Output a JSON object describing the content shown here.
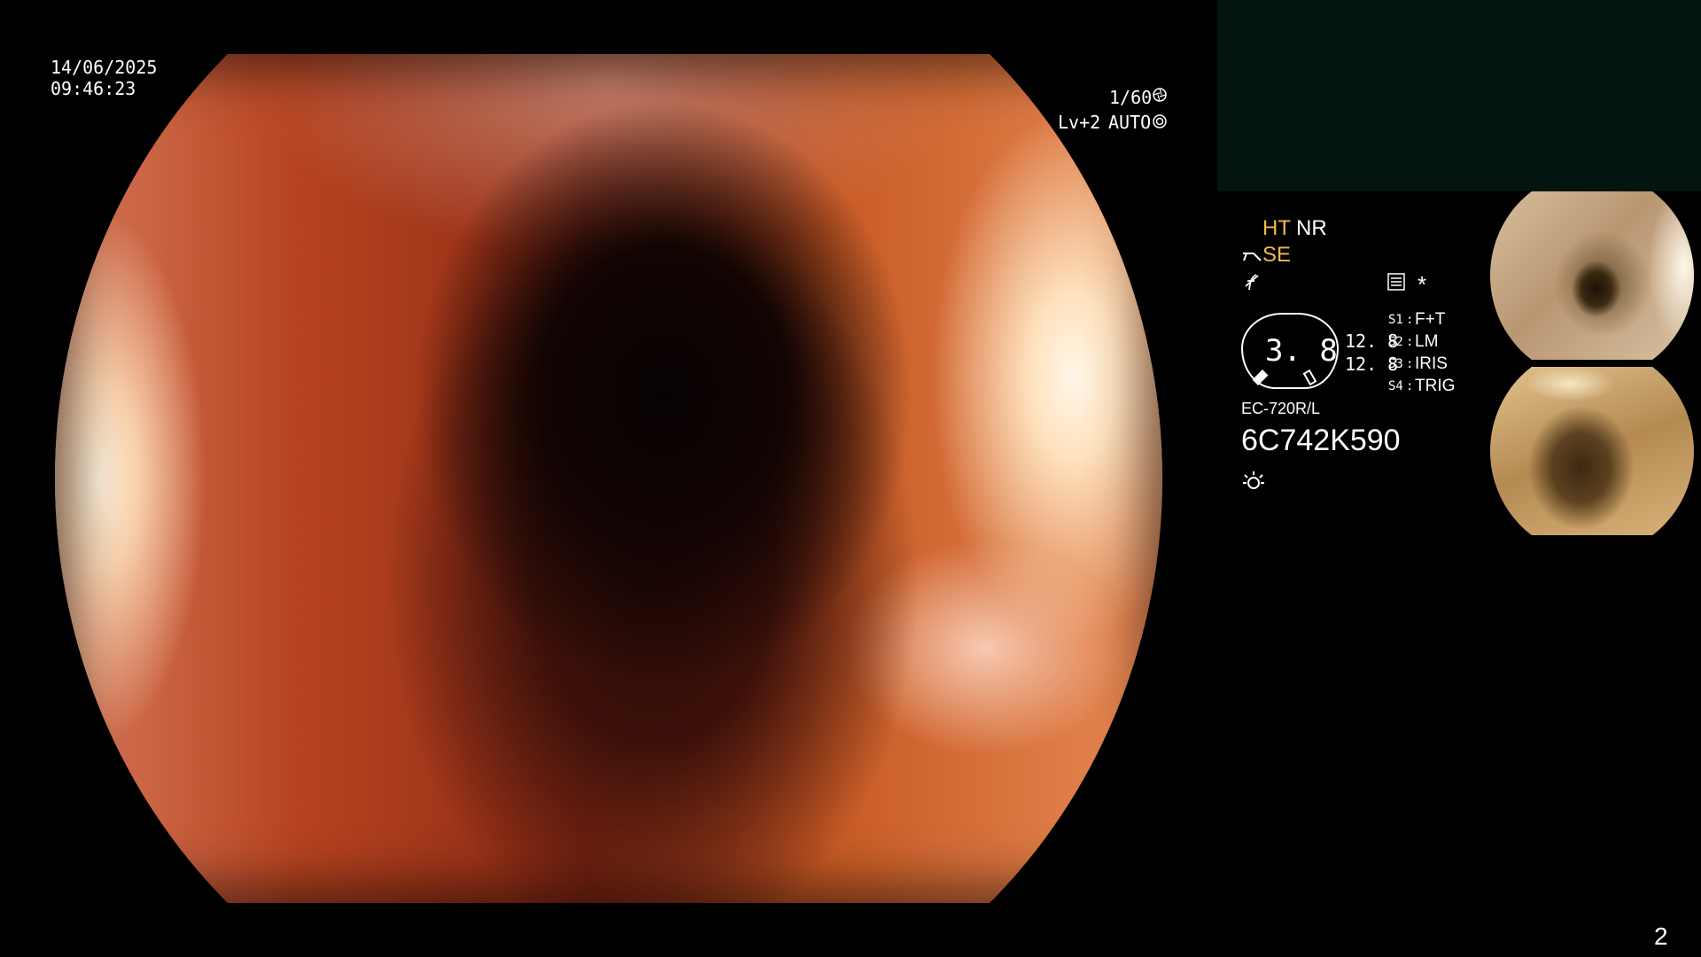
{
  "overlay": {
    "date": "14/06/2025",
    "time": "09:46:23",
    "shutter": "1/60",
    "shutter_icon": "aperture-icon",
    "level": "Lv+2",
    "mode": "AUTO",
    "mode_icon": "target-icon"
  },
  "settings": {
    "ht": "HT",
    "nr": "NR",
    "se": "SE",
    "se_icon": "scope-tip-icon",
    "f_icon": "f-slash-icon",
    "panel_icon": "settings-panel-icon",
    "asterisk": "*",
    "center_value": "3. 8",
    "left_value_top": "12. 8",
    "left_value_bottom": "12. 8",
    "switches": [
      {
        "key": "S1",
        "value": "F+T"
      },
      {
        "key": "S2",
        "value": "LM"
      },
      {
        "key": "S3",
        "value": "IRIS"
      },
      {
        "key": "S4",
        "value": "TRIG"
      }
    ],
    "model": "EC-720R/L",
    "serial": "6C742K590",
    "light_icon": "sun-icon"
  },
  "page_number": "2",
  "colors": {
    "accent_yellow": "#f0b94a",
    "panel_dark": "#041410"
  }
}
